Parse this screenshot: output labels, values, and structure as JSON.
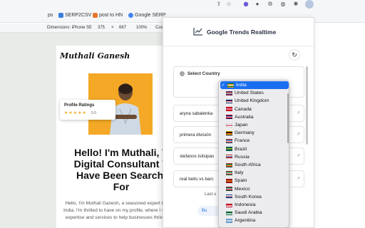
{
  "bookmarks": [
    {
      "label": "ps",
      "color": "#888888"
    },
    {
      "label": "SERP2CSV",
      "color": "#3b7ddd"
    },
    {
      "label": "post to HN",
      "color": "#e8762c"
    },
    {
      "label": "Google SERP",
      "color": "#4285f4"
    }
  ],
  "devtools": {
    "dimensions": "Dimensions: iPhone SE",
    "width": "375",
    "x": "×",
    "height": "667",
    "zoom": "100%",
    "more": "Cus"
  },
  "profile": {
    "name": "Muthali Ganesh",
    "ratings_title": "Profile Ratings",
    "stars": "★★★★★",
    "rating_value": "5.0",
    "headline_lines": [
      "Hello! I'm Muthali, T",
      "Digital Consultant Y",
      "Have Been Searchi",
      "For"
    ],
    "bio": "Hello, I'm Muthali Ganesh, a seasoned expert based in India. I'm thrilled to have on my profile, where I share my expertise and services to help businesses thrive online"
  },
  "popup": {
    "title": "Google Trends Realtime",
    "refresh_icon": "↻",
    "select_country_label": "Select Country",
    "trends": [
      {
        "text": "aryna sabalenka",
        "arrow": "↗"
      },
      {
        "text": "primera división",
        "arrow": "↗"
      },
      {
        "text": "stefanos tsitsipas",
        "arrow": "↗"
      },
      {
        "text": "real betis vs barc",
        "arrow": "↗"
      }
    ],
    "last_label": "Last u",
    "buy_label": "Bu"
  },
  "dropdown": {
    "selected": "India",
    "check": "✓",
    "options": [
      {
        "label": "India",
        "flag": [
          "#ff9933",
          "#ffffff",
          "#138808"
        ]
      },
      {
        "label": "United States",
        "flag": [
          "#b22234",
          "#ffffff",
          "#3c3b6e"
        ]
      },
      {
        "label": "United Kingdom",
        "flag": [
          "#012169",
          "#c8102e",
          "#ffffff"
        ]
      },
      {
        "label": "Canada",
        "flag": [
          "#d80621",
          "#ffffff",
          "#d80621"
        ]
      },
      {
        "label": "Australia",
        "flag": [
          "#012169",
          "#ffffff",
          "#e4002b"
        ]
      },
      {
        "label": "Japan",
        "flag": [
          "#ffffff",
          "#bc002d",
          "#ffffff"
        ]
      },
      {
        "label": "Germany",
        "flag": [
          "#000000",
          "#dd0000",
          "#ffce00"
        ]
      },
      {
        "label": "France",
        "flag": [
          "#0055a4",
          "#ffffff",
          "#ef4135"
        ]
      },
      {
        "label": "Brazil",
        "flag": [
          "#009c3b",
          "#ffdf00",
          "#002776"
        ]
      },
      {
        "label": "Russia",
        "flag": [
          "#ffffff",
          "#0039a6",
          "#d52b1e"
        ]
      },
      {
        "label": "South Africa",
        "flag": [
          "#007a4d",
          "#ffb612",
          "#de3831"
        ]
      },
      {
        "label": "Italy",
        "flag": [
          "#009246",
          "#ffffff",
          "#ce2b37"
        ]
      },
      {
        "label": "Spain",
        "flag": [
          "#aa151b",
          "#f1bf00",
          "#aa151b"
        ]
      },
      {
        "label": "Mexico",
        "flag": [
          "#006847",
          "#ffffff",
          "#ce1126"
        ]
      },
      {
        "label": "South Korea",
        "flag": [
          "#ffffff",
          "#cd2e3a",
          "#0047a0"
        ]
      },
      {
        "label": "Indonesia",
        "flag": [
          "#ce1126",
          "#ce1126",
          "#ffffff"
        ]
      },
      {
        "label": "Saudi Arabia",
        "flag": [
          "#006c35",
          "#006c35",
          "#ffffff"
        ]
      },
      {
        "label": "Argentina",
        "flag": [
          "#74acdf",
          "#ffffff",
          "#74acdf"
        ]
      }
    ]
  },
  "colors": {
    "accent": "#1a6ff0",
    "photo_bg": "#f4a825",
    "star": "#f4a825"
  }
}
